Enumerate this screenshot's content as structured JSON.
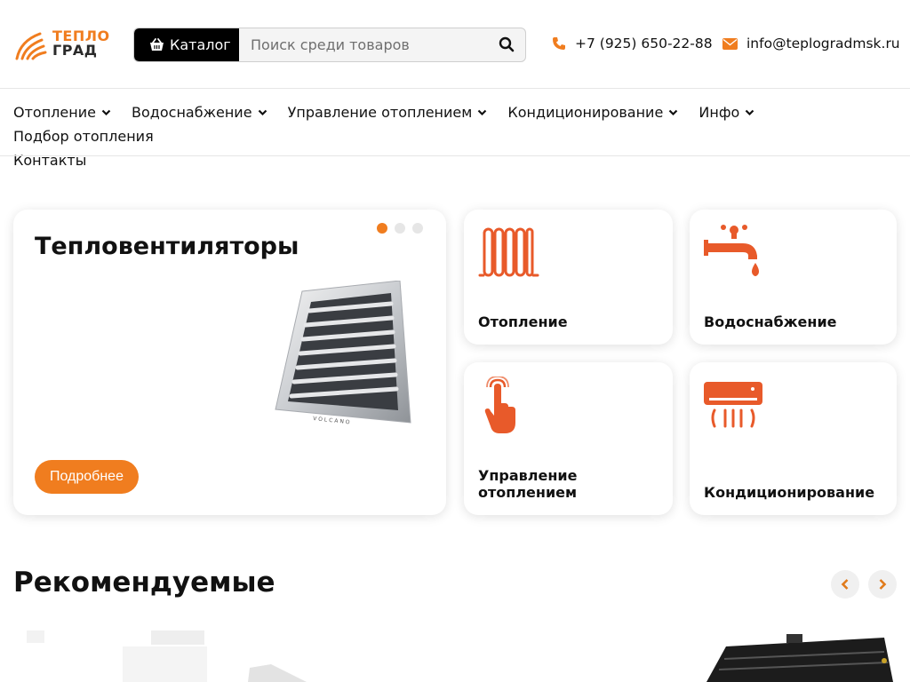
{
  "brand": {
    "line1": "ТЕПЛО",
    "line2": "ГРАД"
  },
  "header": {
    "catalog_label": "Каталог",
    "search_placeholder": "Поиск среди товаров",
    "phone": "+7 (925) 650-22-88",
    "email": "info@teplogradmsk.ru"
  },
  "nav": {
    "items": [
      {
        "label": "Отопление",
        "dropdown": true
      },
      {
        "label": "Водоснабжение",
        "dropdown": true
      },
      {
        "label": "Управление отоплением",
        "dropdown": true
      },
      {
        "label": "Кондиционирование",
        "dropdown": true
      },
      {
        "label": "Инфо",
        "dropdown": true
      },
      {
        "label": "Подбор отопления",
        "dropdown": false
      },
      {
        "label": "Контакты",
        "dropdown": false
      }
    ]
  },
  "hero": {
    "title": "Тепловентиляторы",
    "button": "Подробнее",
    "slides": 3,
    "active_slide": 1,
    "product_mark": "VOLCANO"
  },
  "categories": [
    {
      "label": "Отопление",
      "icon": "radiator-icon"
    },
    {
      "label": "Водоснабжение",
      "icon": "faucet-icon"
    },
    {
      "label": "Управление отоплением",
      "icon": "touch-hand-icon"
    },
    {
      "label": "Кондиционирование",
      "icon": "air-conditioner-icon"
    }
  ],
  "recommended": {
    "title": "Рекомендуемые"
  },
  "colors": {
    "accent": "#f07d1f",
    "dark": "#000000"
  }
}
